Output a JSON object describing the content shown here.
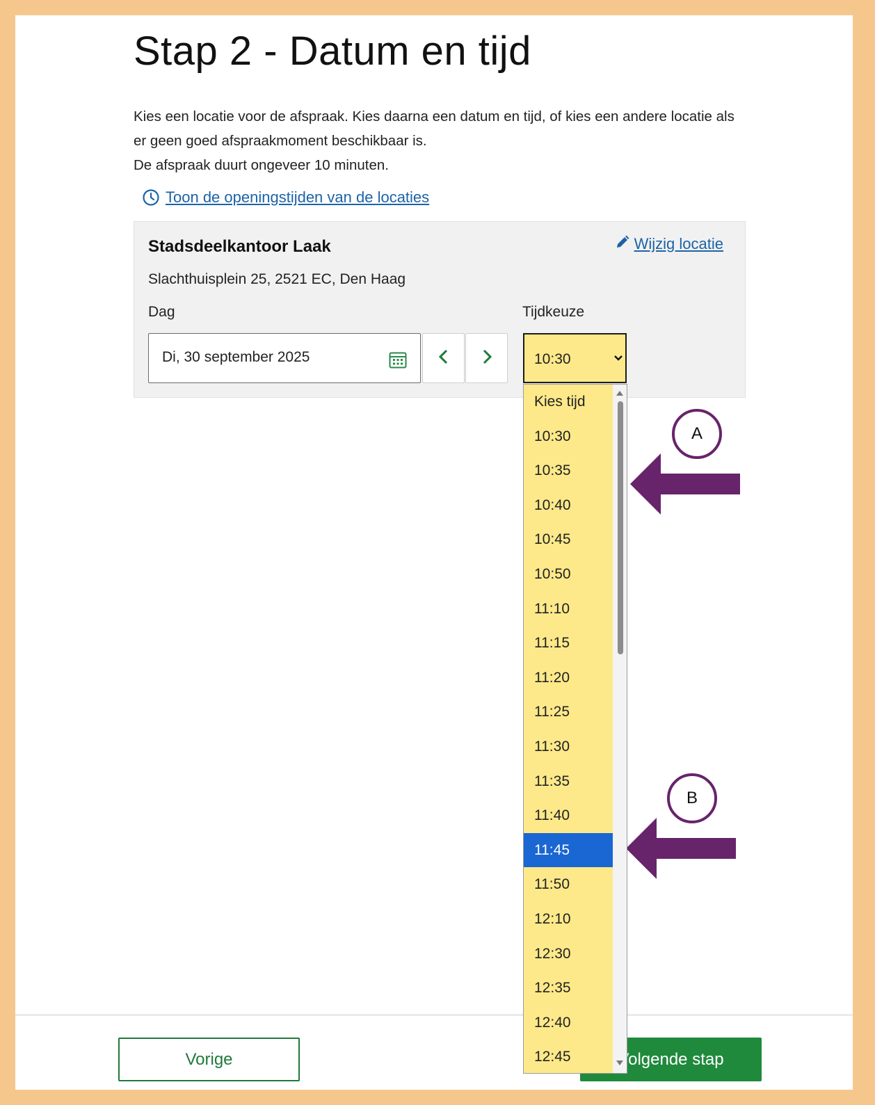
{
  "page": {
    "title": "Stap 2 - Datum en tijd",
    "intro_line_1": "Kies een locatie voor de afspraak. Kies daarna een datum en tijd, of kies een andere locatie als er geen goed afspraakmoment beschikbaar is.",
    "intro_line_2": "De afspraak duurt ongeveer 10 minuten.",
    "opening_hours_link": "Toon de openingstijden van de locaties"
  },
  "location": {
    "name": "Stadsdeelkantoor Laak",
    "address": "Slachthuisplein 25, 2521 EC, Den Haag",
    "edit_label": "Wijzig locatie",
    "day_label": "Dag",
    "day_value": "Di, 30 september 2025",
    "time_label": "Tijdkeuze",
    "time_value": "10:30"
  },
  "time_options": [
    "Kies tijd",
    "10:30",
    "10:35",
    "10:40",
    "10:45",
    "10:50",
    "11:10",
    "11:15",
    "11:20",
    "11:25",
    "11:30",
    "11:35",
    "11:40",
    "11:45",
    "11:50",
    "12:10",
    "12:30",
    "12:35",
    "12:40",
    "12:45"
  ],
  "highlighted_option": "11:45",
  "footer": {
    "prev_label": "Vorige",
    "next_label": "Volgende stap"
  },
  "annotations": {
    "marker_a": "A",
    "marker_b": "B",
    "color": "#67246b"
  },
  "colors": {
    "link": "#1c63a6",
    "primary_green": "#1f8a3c",
    "select_yellow": "#fde98a",
    "selected_blue": "#1a66d2"
  }
}
